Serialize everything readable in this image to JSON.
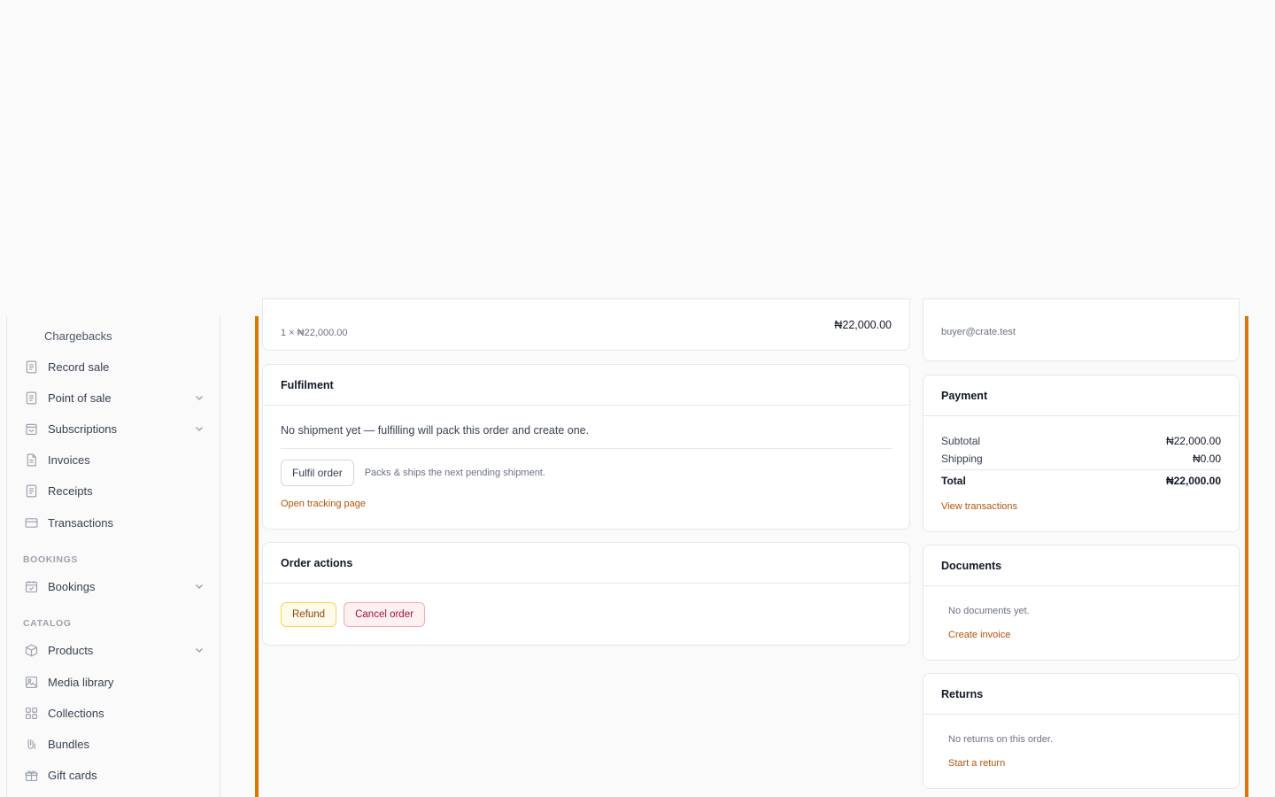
{
  "sidebar": {
    "sub_items": [
      {
        "label": "Chargebacks"
      }
    ],
    "items": [
      {
        "label": "Record sale",
        "icon": "receipt-icon"
      },
      {
        "label": "Point of sale",
        "icon": "receipt-icon"
      },
      {
        "label": "Subscriptions",
        "icon": "bag-icon"
      },
      {
        "label": "Invoices",
        "icon": "document-icon"
      },
      {
        "label": "Receipts",
        "icon": "receipt-icon"
      },
      {
        "label": "Transactions",
        "icon": "card-icon"
      },
      {
        "label": "Bookings",
        "icon": "calendar-icon"
      },
      {
        "label": "Products",
        "icon": "box-icon"
      },
      {
        "label": "Media library",
        "icon": "image-icon"
      },
      {
        "label": "Collections",
        "icon": "grid-icon"
      },
      {
        "label": "Bundles",
        "icon": "bundle-icon"
      },
      {
        "label": "Gift cards",
        "icon": "gift-icon"
      }
    ],
    "sections": {
      "bookings": "BOOKINGS",
      "catalog": "CATALOG"
    }
  },
  "line_item": {
    "qty_price": "1 × ₦22,000.00",
    "total": "₦22,000.00"
  },
  "customer": {
    "email": "buyer@crate.test"
  },
  "fulfilment": {
    "title": "Fulfilment",
    "message": "No shipment yet — fulfilling will pack this order and create one.",
    "button": "Fulfil order",
    "hint": "Packs & ships the next pending shipment.",
    "link": "Open tracking page"
  },
  "order_actions": {
    "title": "Order actions",
    "refund": "Refund",
    "cancel": "Cancel order"
  },
  "payment": {
    "title": "Payment",
    "subtotal_label": "Subtotal",
    "subtotal": "₦22,000.00",
    "shipping_label": "Shipping",
    "shipping": "₦0.00",
    "total_label": "Total",
    "total": "₦22,000.00",
    "link": "View transactions"
  },
  "documents": {
    "title": "Documents",
    "empty": "No documents yet.",
    "link": "Create invoice"
  },
  "returns": {
    "title": "Returns",
    "empty": "No returns on this order.",
    "link": "Start a return"
  },
  "colors": {
    "accent": "#d97706",
    "link": "#b45309"
  }
}
